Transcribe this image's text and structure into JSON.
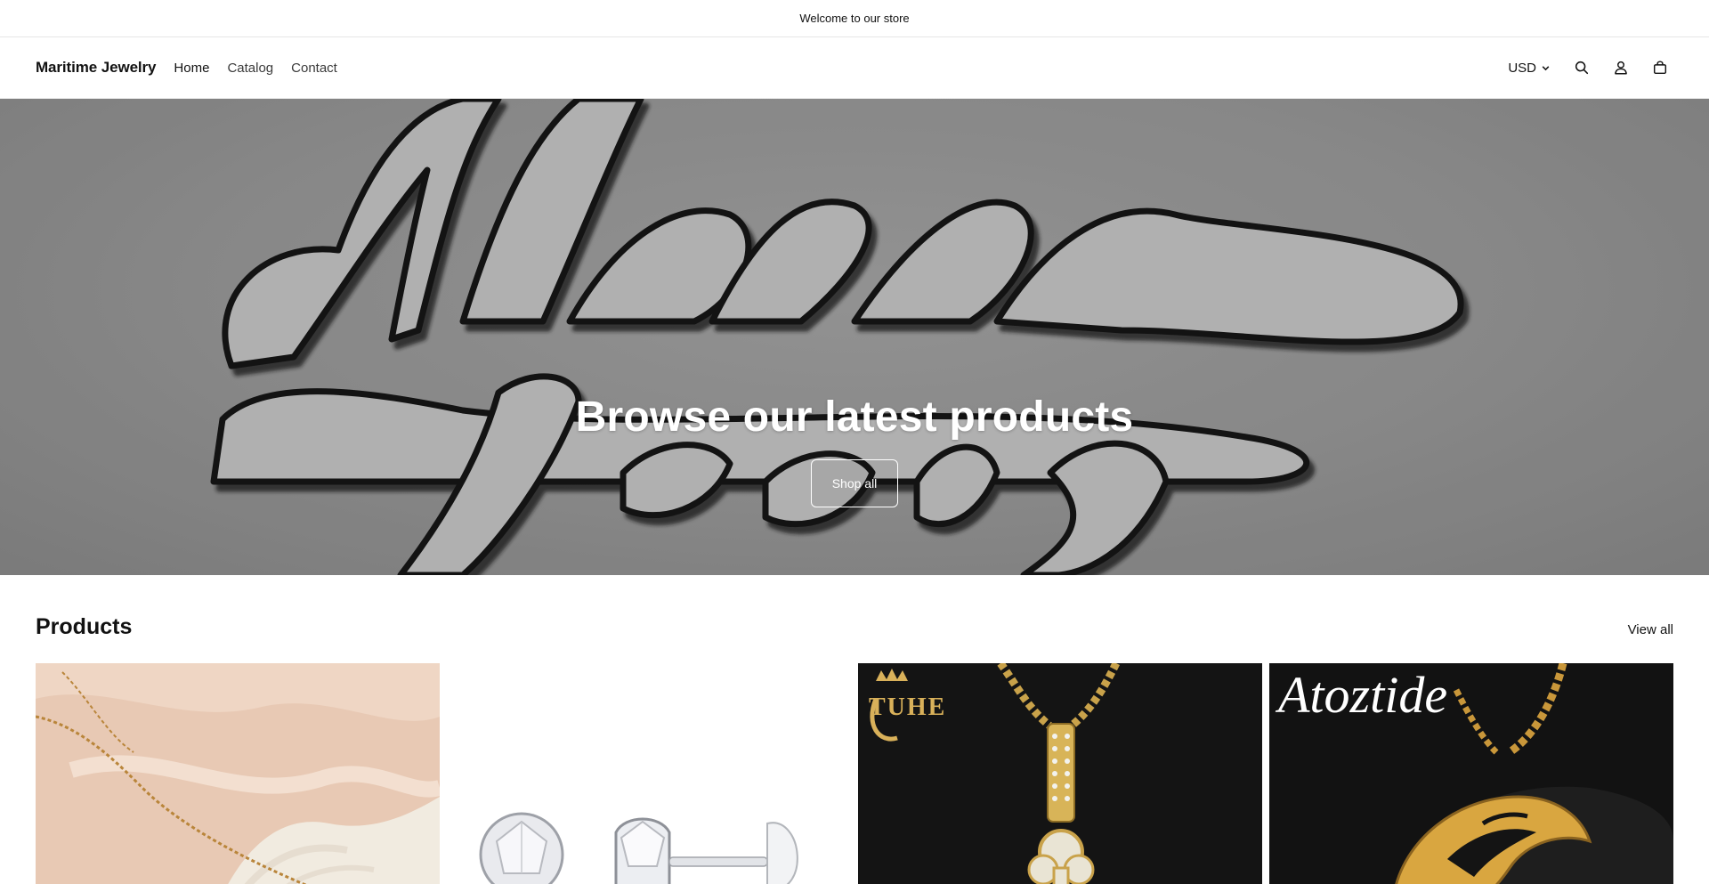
{
  "announcement": {
    "text": "Welcome to our store"
  },
  "header": {
    "logo": "Maritime Jewelry",
    "nav": [
      {
        "label": "Home"
      },
      {
        "label": "Catalog"
      },
      {
        "label": "Contact"
      }
    ],
    "currency": "USD",
    "icons": [
      "search-icon",
      "account-icon",
      "cart-icon",
      "chevron-down-icon"
    ]
  },
  "hero": {
    "heading": "Browse our latest products",
    "button_label": "Shop all"
  },
  "products": {
    "title": "Products",
    "view_all": "View all",
    "cards": [
      {
        "brand": ""
      },
      {
        "brand": ""
      },
      {
        "brand": "TUHE"
      },
      {
        "brand": "Atoztide"
      }
    ]
  },
  "colors": {
    "text": "#121212",
    "hero_bg": "#9a9a9a",
    "gold": "#d9b15a",
    "blush": "#e8c9b4"
  }
}
